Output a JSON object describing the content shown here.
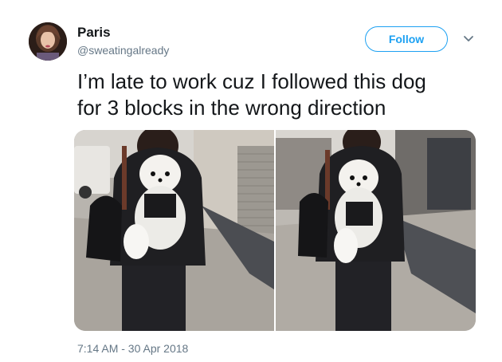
{
  "user": {
    "name": "Paris",
    "handle": "@sweatingalready"
  },
  "actions": {
    "follow_label": "Follow",
    "menu_icon": "chevron-down-icon"
  },
  "tweet": {
    "text_line1": "I’m late to work cuz I followed this dog",
    "text_line2": "for 3 blocks in the wrong direction",
    "timestamp": "7:14 AM - 30 Apr 2018"
  },
  "colors": {
    "accent": "#1da1f2",
    "secondary_text": "#657786",
    "primary_text": "#14171a"
  }
}
